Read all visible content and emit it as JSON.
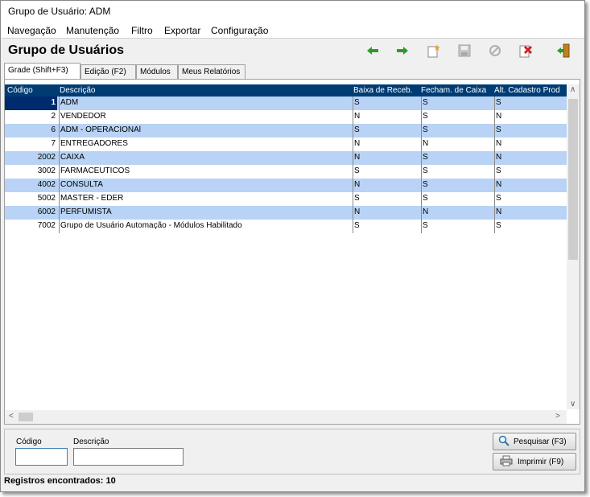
{
  "window": {
    "title": "Grupo de Usuário: ADM"
  },
  "menu": [
    {
      "label": "Navegação"
    },
    {
      "label": "Manutenção"
    },
    {
      "label": "Filtro"
    },
    {
      "label": "Exportar"
    },
    {
      "label": "Configuração"
    }
  ],
  "header": {
    "title": "Grupo de Usuários"
  },
  "toolbar": {
    "icons": [
      "back-arrow-icon",
      "forward-arrow-icon",
      "new-record-icon",
      "save-icon",
      "cancel-icon",
      "delete-icon",
      "exit-icon"
    ],
    "colors": {
      "arrow": "#2e9a2e",
      "delete": "#d42020",
      "new": "#f0a020"
    }
  },
  "tabs": [
    {
      "label": "Grade (Shift+F3)"
    },
    {
      "label": "Edição (F2)"
    },
    {
      "label": "Módulos"
    },
    {
      "label": "Meus Relatórios"
    }
  ],
  "grid": {
    "columns": [
      "Código",
      "Descrição",
      "Baixa de Receb.",
      "Fecham. de Caixa",
      "Alt. Cadastro Prod"
    ],
    "rows": [
      {
        "codigo": "1",
        "descricao": "ADM",
        "baixa": "S",
        "fecham": "S",
        "alt": "S"
      },
      {
        "codigo": "2",
        "descricao": "VENDEDOR",
        "baixa": "N",
        "fecham": "S",
        "alt": "N"
      },
      {
        "codigo": "6",
        "descricao": "ADM - OPERACIONAl",
        "baixa": "S",
        "fecham": "S",
        "alt": "S"
      },
      {
        "codigo": "7",
        "descricao": "ENTREGADORES",
        "baixa": "N",
        "fecham": "N",
        "alt": "N"
      },
      {
        "codigo": "2002",
        "descricao": "CAIXA",
        "baixa": "N",
        "fecham": "S",
        "alt": "N"
      },
      {
        "codigo": "3002",
        "descricao": "FARMACEUTICOS",
        "baixa": "S",
        "fecham": "S",
        "alt": "S"
      },
      {
        "codigo": "4002",
        "descricao": "CONSULTA",
        "baixa": "N",
        "fecham": "S",
        "alt": "N"
      },
      {
        "codigo": "5002",
        "descricao": "MASTER - EDER",
        "baixa": "S",
        "fecham": "S",
        "alt": "S"
      },
      {
        "codigo": "6002",
        "descricao": "PERFUMISTA",
        "baixa": "N",
        "fecham": "N",
        "alt": "N"
      },
      {
        "codigo": "7002",
        "descricao": "Grupo de Usuário Automação - Módulos Habilitado",
        "baixa": "S",
        "fecham": "S",
        "alt": "S"
      }
    ],
    "colors": {
      "header": "#003c74",
      "alt_row": "#b8d3f5",
      "selected": "#002a6e"
    }
  },
  "search": {
    "codigo_label": "Código",
    "codigo_value": "",
    "descricao_label": "Descrição",
    "descricao_value": "",
    "search_button": "Pesquisar (F3)",
    "print_button": "Imprimir (F9)"
  },
  "status": {
    "text": "Registros encontrados: 10"
  }
}
